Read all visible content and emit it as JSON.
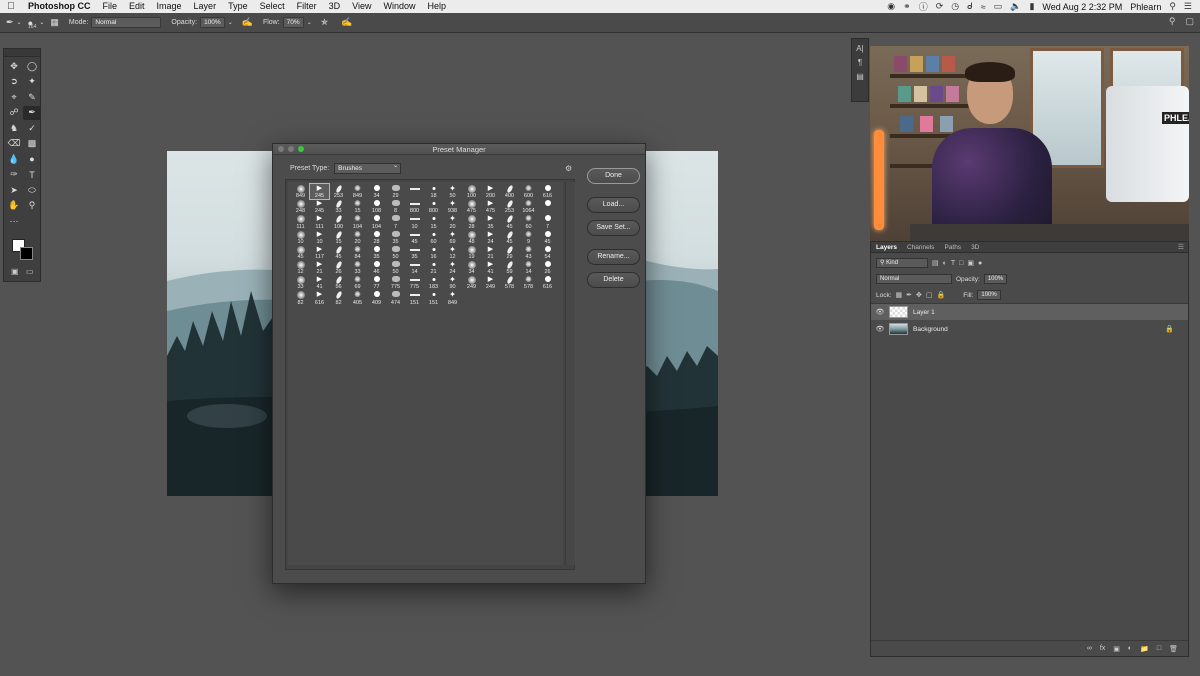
{
  "menubar": {
    "app_name": "Photoshop CC",
    "items": [
      "File",
      "Edit",
      "Image",
      "Layer",
      "Type",
      "Select",
      "Filter",
      "3D",
      "View",
      "Window",
      "Help"
    ],
    "clock": "Wed Aug 2  2:32 PM",
    "user": "Phlearn"
  },
  "options_bar": {
    "brush_size": "164",
    "mode_label": "Mode:",
    "mode_value": "Normal",
    "opacity_label": "Opacity:",
    "opacity_value": "100%",
    "flow_label": "Flow:",
    "flow_value": "70%"
  },
  "dialog": {
    "title": "Preset Manager",
    "preset_type_label": "Preset Type:",
    "preset_type_value": "Brushes",
    "buttons": {
      "done": "Done",
      "load": "Load...",
      "save_set": "Save Set...",
      "rename": "Rename...",
      "delete": "Delete"
    },
    "brush_sizes": [
      "849",
      "245",
      "253",
      "849",
      "34",
      "29",
      "",
      "18",
      "50",
      "100",
      "200",
      "400",
      "600",
      "616",
      "248",
      "245",
      "33",
      "15",
      "108",
      "8",
      "800",
      "800",
      "938",
      "475",
      "475",
      "253",
      "1064",
      "",
      "111",
      "111",
      "100",
      "104",
      "104",
      "7",
      "10",
      "15",
      "20",
      "28",
      "35",
      "45",
      "60",
      "7",
      "10",
      "10",
      "15",
      "20",
      "28",
      "35",
      "45",
      "60",
      "69",
      "48",
      "24",
      "45",
      "9",
      "45",
      "45",
      "117",
      "45",
      "84",
      "35",
      "50",
      "35",
      "16",
      "12",
      "19",
      "21",
      "29",
      "43",
      "54",
      "12",
      "21",
      "26",
      "33",
      "46",
      "50",
      "14",
      "21",
      "24",
      "34",
      "41",
      "59",
      "14",
      "26",
      "33",
      "41",
      "56",
      "69",
      "77",
      "775",
      "775",
      "183",
      "90",
      "249",
      "249",
      "578",
      "578",
      "616",
      "82",
      "616",
      "82",
      "405",
      "409",
      "474",
      "151",
      "151",
      "849"
    ]
  },
  "layers_panel": {
    "tabs": [
      "Layers",
      "Channels",
      "Paths",
      "3D"
    ],
    "filter_kind": "Kind",
    "blend_mode": "Normal",
    "opacity_label": "Opacity:",
    "opacity_value": "100%",
    "lock_label": "Lock:",
    "fill_label": "Fill:",
    "fill_value": "100%",
    "layers": [
      {
        "name": "Layer 1",
        "selected": true
      },
      {
        "name": "Background",
        "selected": false,
        "locked": true
      }
    ]
  },
  "video_overlay": {
    "monitor_logo": "PHLEA"
  }
}
